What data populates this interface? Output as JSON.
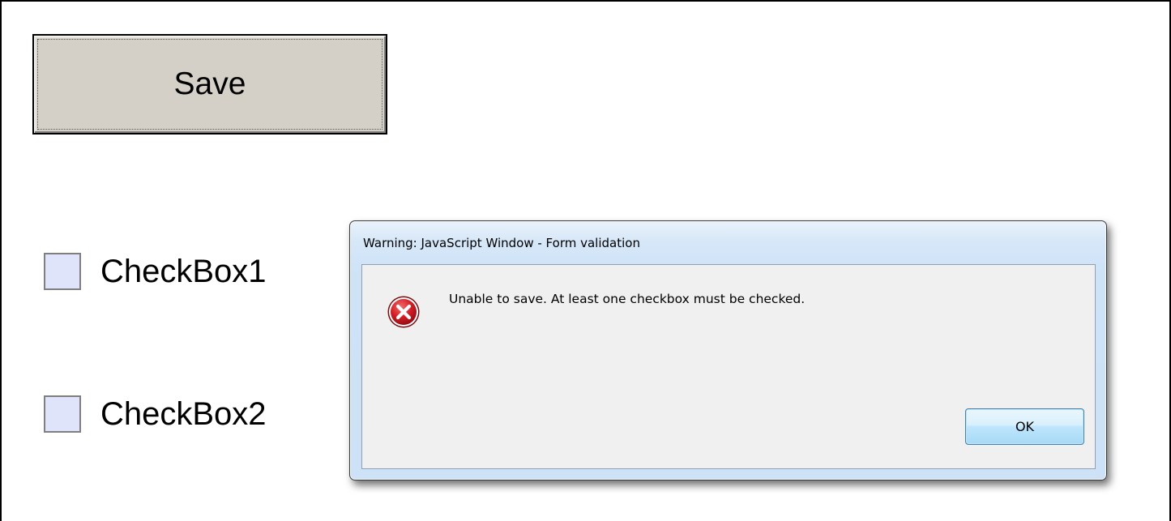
{
  "form": {
    "save_button_label": "Save",
    "checkboxes": [
      {
        "label": "CheckBox1",
        "checked": false
      },
      {
        "label": "CheckBox2",
        "checked": false
      }
    ]
  },
  "dialog": {
    "title": "Warning: JavaScript Window - Form validation",
    "message": "Unable to save. At least one checkbox must be checked.",
    "icon": "error-icon",
    "ok_label": "OK"
  },
  "colors": {
    "save_button_bg": "#d4d0c8",
    "checkbox_fill": "#dfe4fb",
    "dialog_frame": "#cde2f6",
    "dialog_body": "#f0f0f0",
    "error_red": "#c8171e"
  }
}
